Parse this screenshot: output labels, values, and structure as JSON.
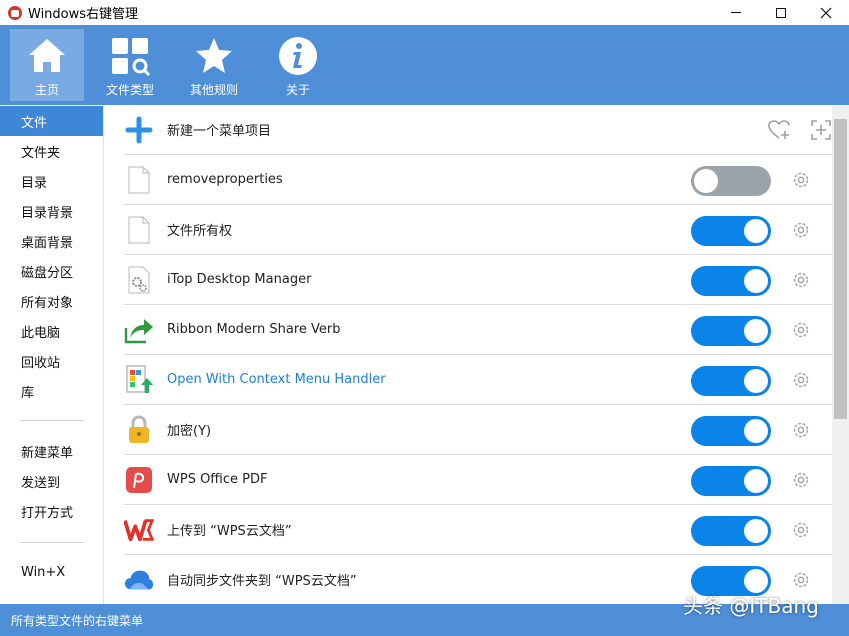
{
  "window": {
    "title": "Windows右键管理",
    "accent_color": "#4f8fd8"
  },
  "toolbar": {
    "items": [
      {
        "label": "主页",
        "icon": "home-icon",
        "active": true
      },
      {
        "label": "文件类型",
        "icon": "file-types-icon",
        "active": false
      },
      {
        "label": "其他规则",
        "icon": "star-icon",
        "active": false
      },
      {
        "label": "关于",
        "icon": "info-icon",
        "active": false
      }
    ]
  },
  "sidebar": {
    "items": [
      {
        "label": "文件",
        "active": true
      },
      {
        "label": "文件夹"
      },
      {
        "label": "目录"
      },
      {
        "label": "目录背景"
      },
      {
        "label": "桌面背景"
      },
      {
        "label": "磁盘分区"
      },
      {
        "label": "所有对象"
      },
      {
        "label": "此电脑"
      },
      {
        "label": "回收站"
      },
      {
        "label": "库"
      },
      {
        "label": "新建菜单"
      },
      {
        "label": "发送到"
      },
      {
        "label": "打开方式"
      },
      {
        "label": "Win+X"
      }
    ]
  },
  "main": {
    "new_item_label": "新建一个菜单项目",
    "rows": [
      {
        "label": "removeproperties",
        "icon": "blank-file-icon",
        "enabled": false
      },
      {
        "label": "文件所有权",
        "icon": "blank-file-icon",
        "enabled": true
      },
      {
        "label": "iTop Desktop Manager",
        "icon": "gear-file-icon",
        "enabled": true
      },
      {
        "label": "Ribbon Modern Share Verb",
        "icon": "share-arrow-icon",
        "enabled": true
      },
      {
        "label": "Open With Context Menu Handler",
        "icon": "open-with-icon",
        "enabled": true,
        "highlighted": true
      },
      {
        "label": "加密(Y)",
        "icon": "lock-icon",
        "enabled": true
      },
      {
        "label": "WPS Office PDF",
        "icon": "wps-pdf-icon",
        "enabled": true
      },
      {
        "label": "上传到 “WPS云文档”",
        "icon": "wps-logo-icon",
        "enabled": true
      },
      {
        "label": "自动同步文件夹到 “WPS云文档”",
        "icon": "cloud-icon",
        "enabled": true
      }
    ]
  },
  "statusbar": {
    "text": "所有类型文件的右键菜单"
  },
  "watermark": "头条 @ITBang"
}
